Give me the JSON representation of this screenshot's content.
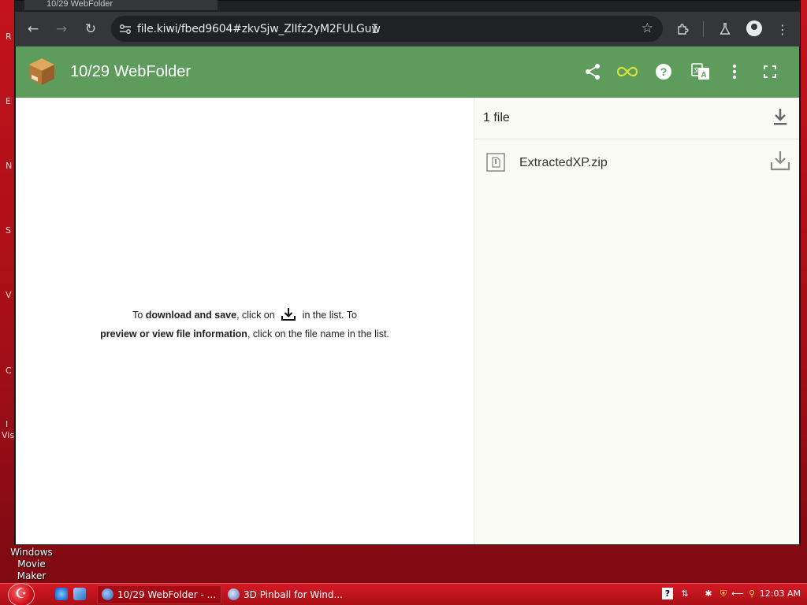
{
  "desktop": {
    "edge_letters": [
      "R",
      "E",
      "N",
      "S",
      "V",
      "C",
      "I",
      "Vis"
    ],
    "icon_label": "Windows Movie Maker"
  },
  "browser": {
    "tab_title": "10/29 WebFolder",
    "url": "file.kiwi/fbed9604#zkvSjw_ZlIfz2yM2FULGuw",
    "icons": {
      "back": "back-arrow-icon",
      "forward": "forward-arrow-icon",
      "reload": "reload-icon",
      "site_info": "site-info-icon",
      "bookmark": "star-icon",
      "extensions": "puzzle-icon",
      "labs": "flask-icon",
      "profile": "profile-icon",
      "menu": "kebab-menu-icon"
    }
  },
  "app": {
    "title": "10/29 WebFolder",
    "header_icons": [
      "share-icon",
      "infinity-icon",
      "help-icon",
      "translate-icon",
      "more-vert-icon",
      "fullscreen-icon"
    ],
    "colors": {
      "header_bg": "#5e9c5d",
      "infinity": "#d6e23a",
      "panel_bg": "#fbfbf5"
    }
  },
  "hint": {
    "part1": "To ",
    "bold1": "download and save",
    "part2": ", click on ",
    "part3": " in the list. To",
    "bold2": "preview or view file information",
    "part4": ", click on the file name in the list."
  },
  "files": {
    "count_label": "1 file",
    "items": [
      {
        "name": "ExtractedXP.zip"
      }
    ]
  },
  "taskbar": {
    "tasks": [
      {
        "label": "10/29 WebFolder - ...",
        "active": true
      },
      {
        "label": "3D Pinball for Wind...",
        "active": false
      }
    ],
    "clock": "12:03 AM",
    "colors": {
      "bar": "#c8141e"
    }
  }
}
